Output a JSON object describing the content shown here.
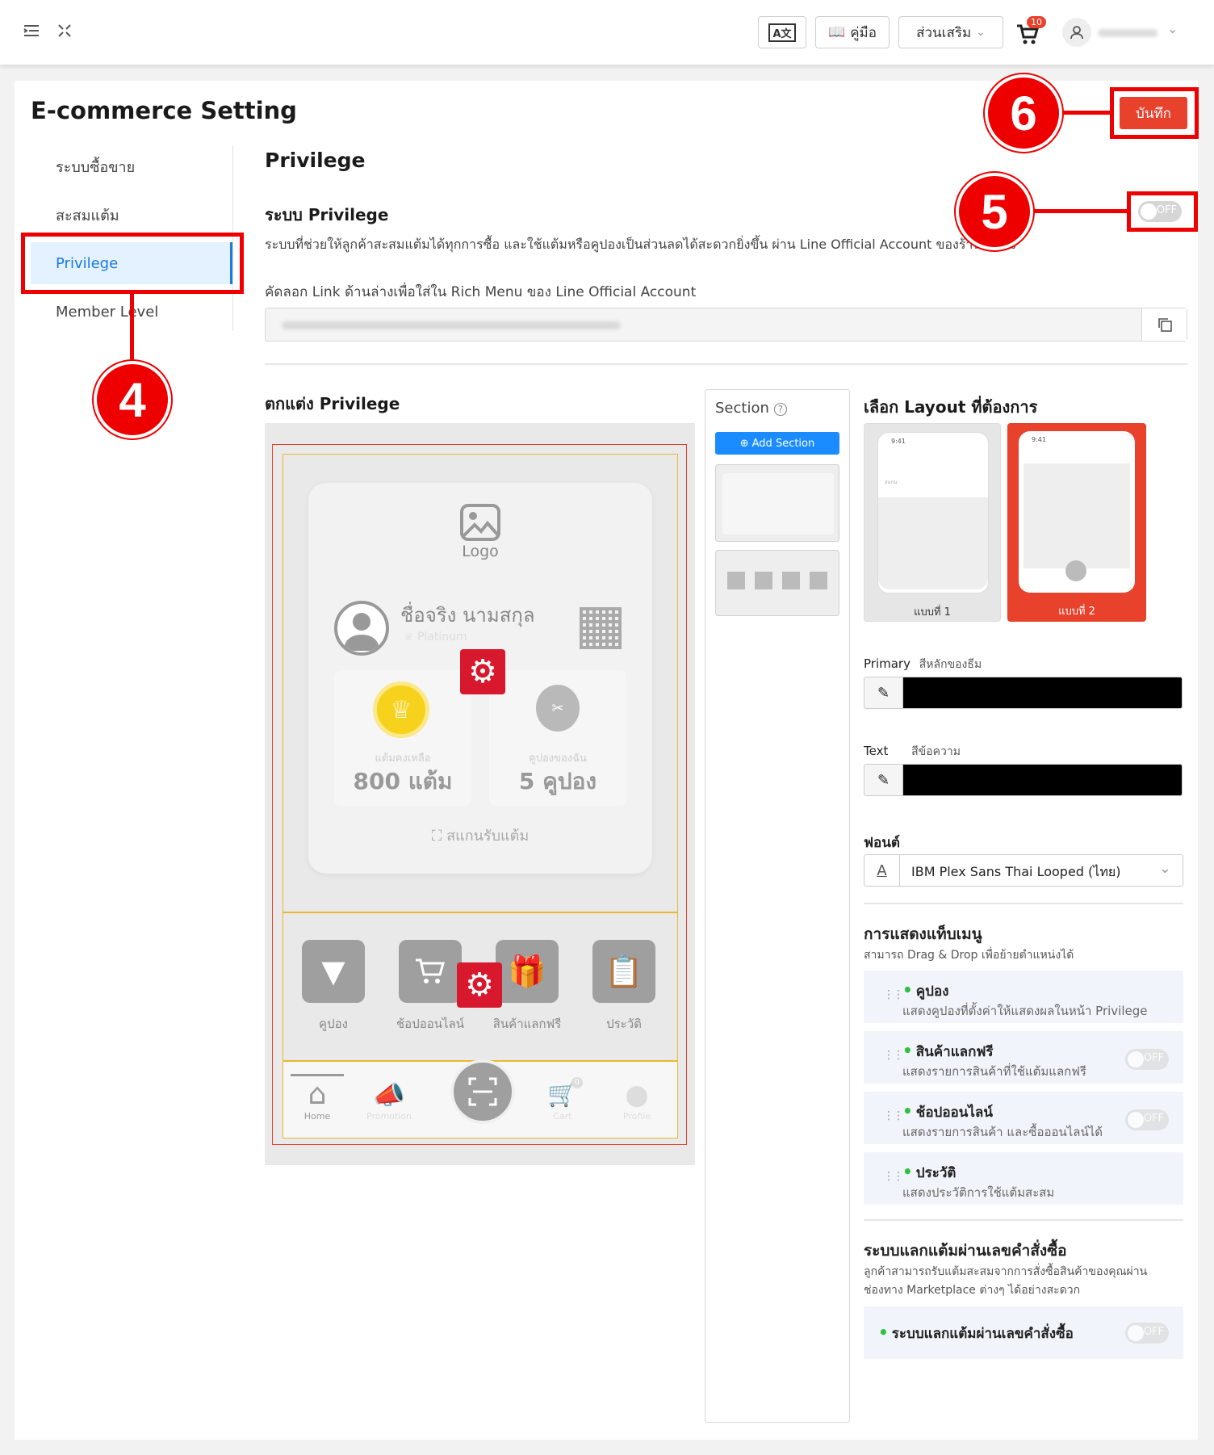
{
  "topbar": {
    "translate_label": "A文",
    "manual_label": "คู่มือ",
    "addons_label": "ส่วนเสริม",
    "cart_count": "10",
    "menu_icon": "menu-icon",
    "expand_icon": "expand-icon",
    "cart_icon": "cart-icon",
    "user_icon": "user-icon"
  },
  "page": {
    "title": "E-commerce Setting",
    "save_label": "บันทึก"
  },
  "sidebar": {
    "items": [
      {
        "label": "ระบบซื้อขาย"
      },
      {
        "label": "สะสมแต้ม"
      },
      {
        "label": "Privilege"
      },
      {
        "label": "Member Level"
      }
    ]
  },
  "callouts": {
    "c4": "4",
    "c5": "5",
    "c6": "6"
  },
  "privilege": {
    "heading": "Privilege",
    "system_title": "ระบบ Privilege",
    "system_desc": "ระบบที่ช่วยให้ลูกค้าสะสมแต้มได้ทุกการซื้อ และใช้แต้มหรือคูปองเป็นส่วนลดได้สะดวกยิ่งขึ้น ผ่าน Line Official Account ของร้านค้าเอง",
    "toggle_label": "OFF",
    "link_hint": "คัดลอก Link ด้านล่างเพื่อใส่ใน Rich Menu ของ Line Official Account",
    "customize_title": "ตกแต่ง Privilege"
  },
  "preview": {
    "logo": "Logo",
    "name": "ชื่อจริง นามสกุล",
    "tier": "Platinum",
    "points_caption": "แต้มคงเหลือ",
    "points_value": "800 แต้ม",
    "coupons_caption": "คูปองของฉัน",
    "coupons_value": "5 คูปอง",
    "scan_label": "สแกนรับแต้ม",
    "tiles": [
      "คูปอง",
      "ช้อปออนไลน์",
      "สินค้าแลกฟรี",
      "ประวัติ"
    ],
    "nav": [
      "Home",
      "Promotion",
      "Cart",
      "Profile"
    ],
    "nav_cart_count": "0"
  },
  "section_panel": {
    "title": "Section",
    "add_label": "Add Section"
  },
  "layout": {
    "title": "เลือก Layout ที่ต้องการ",
    "options": [
      {
        "label": "แบบที่ 1",
        "time": "9:41",
        "hint": "สแกน"
      },
      {
        "label": "แบบที่ 2",
        "time": "9:41"
      }
    ]
  },
  "colors": {
    "primary_label": "Primary",
    "primary_sub": "สีหลักของธีม",
    "primary_value": "#000000",
    "text_label": "Text",
    "text_sub": "สีข้อความ",
    "text_value": "#000000",
    "accent": "#e8412c",
    "link_blue": "#1a7be0"
  },
  "font": {
    "title": "ฟอนต์",
    "value": "IBM Plex Sans Thai Looped (ไทย)"
  },
  "tab_menu": {
    "title": "การแสดงแท็บเมนู",
    "desc": "สามารถ Drag & Drop เพื่อย้ายตำแหน่งได้",
    "items": [
      {
        "title": "คูปอง",
        "desc": "แสดงคูปองที่ตั้งค่าให้แสดงผลในหน้า Privilege"
      },
      {
        "title": "สินค้าแลกฟรี",
        "desc": "แสดงรายการสินค้าที่ใช้แต้มแลกฟรี",
        "toggle": "OFF"
      },
      {
        "title": "ช้อปออนไลน์",
        "desc": "แสดงรายการสินค้า และซื้อออนไลน์ได้",
        "toggle": "OFF"
      },
      {
        "title": "ประวัติ",
        "desc": "แสดงประวัติการใช้แต้มสะสม"
      }
    ]
  },
  "order_points": {
    "title": "ระบบแลกแต้มผ่านเลขคำสั่งซื้อ",
    "desc1": "ลูกค้าสามารถรับแต้มสะสมจากการสั่งซื้อสินค้าของคุณผ่าน",
    "desc2": "ช่องทาง Marketplace ต่างๆ ได้อย่างสะดวก",
    "item_title": "ระบบแลกแต้มผ่านเลขคำสั่งซื้อ",
    "toggle": "OFF"
  }
}
